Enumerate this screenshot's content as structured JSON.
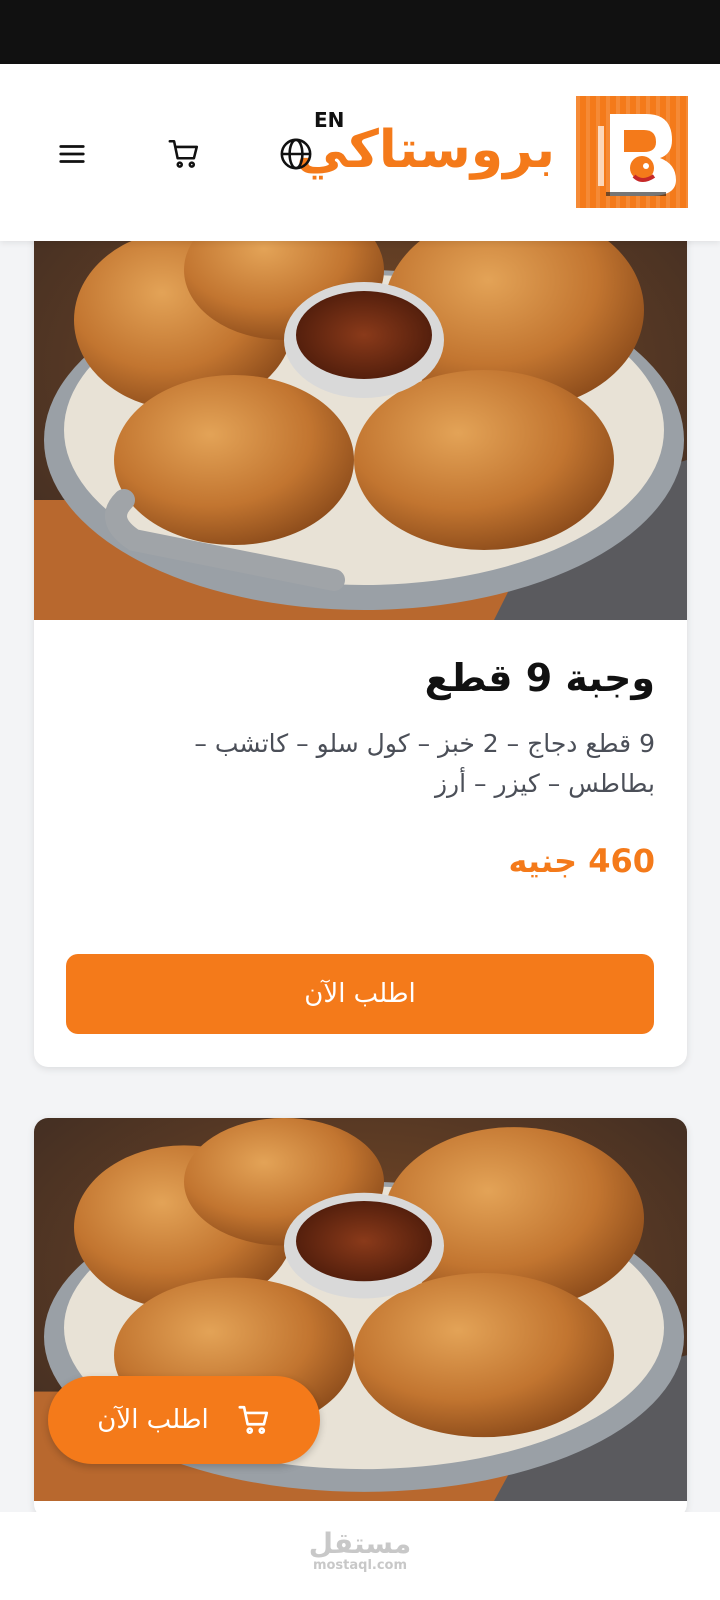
{
  "header": {
    "brand_name": "بروستاكي",
    "language_toggle": "EN",
    "logo_alt": "BROASTAKY"
  },
  "icons": {
    "globe": "globe-icon",
    "cart": "cart-icon",
    "menu": "menu-icon"
  },
  "products": [
    {
      "title": "وجبة 9 قطع",
      "description": "9 قطع دجاج – 2 خبز – كول سلو – كاتشب – بطاطس – كيزر – أرز",
      "price": "460 جنيه",
      "order_label": "اطلب الآن"
    },
    {
      "title": "",
      "description": "",
      "price": "",
      "order_label": ""
    }
  ],
  "floating_order": {
    "label": "اطلب الآن"
  },
  "watermark": {
    "arabic": "مستقل",
    "latin": "mostaql.com"
  },
  "colors": {
    "accent": "#f47a1a",
    "status_bar": "#111111",
    "background": "#f3f4f6"
  }
}
